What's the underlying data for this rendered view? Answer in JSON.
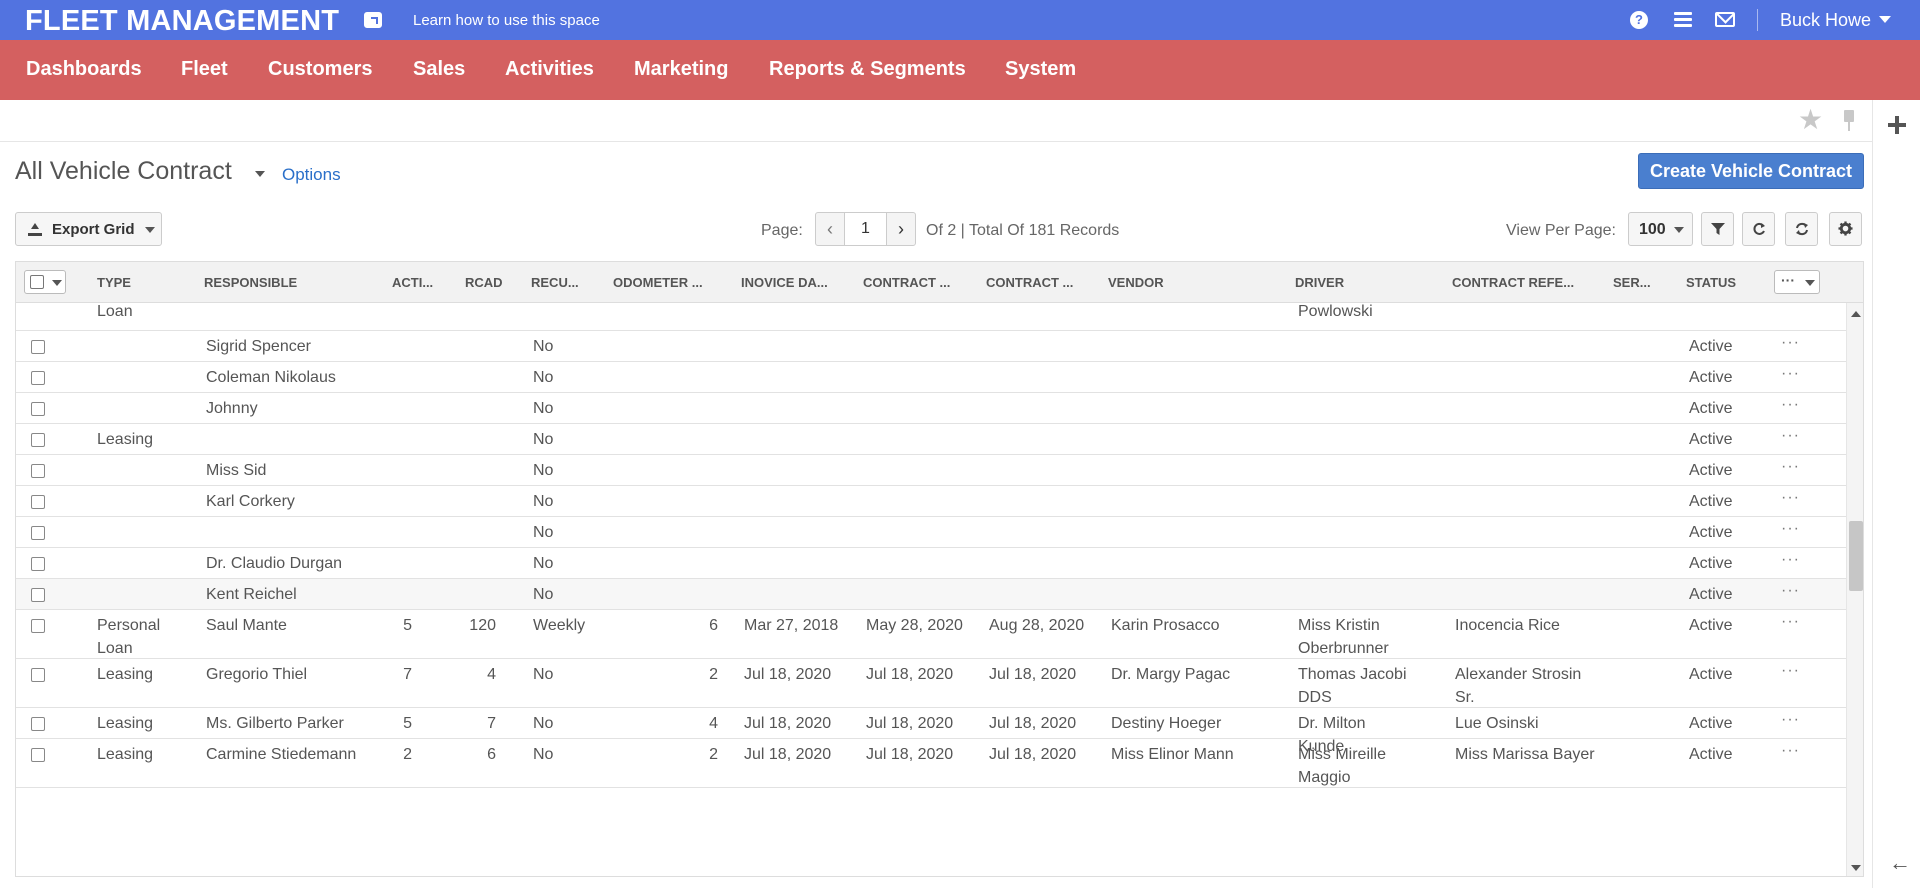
{
  "header": {
    "brand": "FLEET MANAGEMENT",
    "learn": "Learn how to use this space",
    "user": "Buck Howe",
    "icons": [
      "external-link-icon",
      "help-icon",
      "list-icon",
      "mail-icon"
    ]
  },
  "nav": [
    "Dashboards",
    "Fleet",
    "Customers",
    "Sales",
    "Activities",
    "Marketing",
    "Reports & Segments",
    "System"
  ],
  "page": {
    "title": "All Vehicle Contract",
    "options": "Options",
    "create_button": "Create Vehicle Contract"
  },
  "toolbar": {
    "export": "Export Grid",
    "page_label": "Page:",
    "page_value": "1",
    "records": "Of 2 | Total Of 181 Records",
    "view_per_page_label": "View Per Page:",
    "view_per_page_value": "100"
  },
  "grid": {
    "columns": [
      "TYPE",
      "RESPONSIBLE",
      "ACTI...",
      "RCAD",
      "RECU...",
      "ODOMETER ...",
      "INOVICE DA...",
      "CONTRACT ...",
      "CONTRACT ...",
      "VENDOR",
      "DRIVER",
      "CONTRACT REFE...",
      "SER...",
      "STATUS"
    ],
    "partial_row": {
      "type": "Loan",
      "driver": "Powlowski"
    },
    "rows": [
      {
        "type": "",
        "responsible": "Sigrid Spencer",
        "acti": "",
        "rcad": "",
        "recu": "No",
        "odometer": "",
        "invoice": "",
        "contract1": "",
        "contract2": "",
        "vendor": "",
        "driver": "",
        "contract_ref": "",
        "status": "Active"
      },
      {
        "type": "",
        "responsible": "Coleman Nikolaus",
        "acti": "",
        "rcad": "",
        "recu": "No",
        "odometer": "",
        "invoice": "",
        "contract1": "",
        "contract2": "",
        "vendor": "",
        "driver": "",
        "contract_ref": "",
        "status": "Active"
      },
      {
        "type": "",
        "responsible": "Johnny",
        "acti": "",
        "rcad": "",
        "recu": "No",
        "odometer": "",
        "invoice": "",
        "contract1": "",
        "contract2": "",
        "vendor": "",
        "driver": "",
        "contract_ref": "",
        "status": "Active"
      },
      {
        "type": "Leasing",
        "responsible": "",
        "acti": "",
        "rcad": "",
        "recu": "No",
        "odometer": "",
        "invoice": "",
        "contract1": "",
        "contract2": "",
        "vendor": "",
        "driver": "",
        "contract_ref": "",
        "status": "Active"
      },
      {
        "type": "",
        "responsible": "Miss Sid",
        "acti": "",
        "rcad": "",
        "recu": "No",
        "odometer": "",
        "invoice": "",
        "contract1": "",
        "contract2": "",
        "vendor": "",
        "driver": "",
        "contract_ref": "",
        "status": "Active"
      },
      {
        "type": "",
        "responsible": "Karl Corkery",
        "acti": "",
        "rcad": "",
        "recu": "No",
        "odometer": "",
        "invoice": "",
        "contract1": "",
        "contract2": "",
        "vendor": "",
        "driver": "",
        "contract_ref": "",
        "status": "Active"
      },
      {
        "type": "",
        "responsible": "",
        "acti": "",
        "rcad": "",
        "recu": "No",
        "odometer": "",
        "invoice": "",
        "contract1": "",
        "contract2": "",
        "vendor": "",
        "driver": "",
        "contract_ref": "",
        "status": "Active"
      },
      {
        "type": "",
        "responsible": "Dr. Claudio Durgan",
        "acti": "",
        "rcad": "",
        "recu": "No",
        "odometer": "",
        "invoice": "",
        "contract1": "",
        "contract2": "",
        "vendor": "",
        "driver": "",
        "contract_ref": "",
        "status": "Active"
      },
      {
        "type": "",
        "responsible": "Kent Reichel",
        "acti": "",
        "rcad": "",
        "recu": "No",
        "odometer": "",
        "invoice": "",
        "contract1": "",
        "contract2": "",
        "vendor": "",
        "driver": "",
        "contract_ref": "",
        "status": "Active"
      },
      {
        "type": "Personal Loan",
        "responsible": "Saul Mante",
        "acti": "5",
        "rcad": "120",
        "recu": "Weekly",
        "odometer": "6",
        "invoice": "Mar 27, 2018",
        "contract1": "May 28, 2020",
        "contract2": "Aug 28, 2020",
        "vendor": "Karin Prosacco",
        "driver": "Miss Kristin Oberbrunner",
        "contract_ref": "Inocencia Rice",
        "status": "Active"
      },
      {
        "type": "Leasing",
        "responsible": "Gregorio Thiel",
        "acti": "7",
        "rcad": "4",
        "recu": "No",
        "odometer": "2",
        "invoice": "Jul 18, 2020",
        "contract1": "Jul 18, 2020",
        "contract2": "Jul 18, 2020",
        "vendor": "Dr. Margy Pagac",
        "driver": "Thomas Jacobi DDS",
        "contract_ref": "Alexander Strosin Sr.",
        "status": "Active"
      },
      {
        "type": "Leasing",
        "responsible": "Ms. Gilberto Parker",
        "acti": "5",
        "rcad": "7",
        "recu": "No",
        "odometer": "4",
        "invoice": "Jul 18, 2020",
        "contract1": "Jul 18, 2020",
        "contract2": "Jul 18, 2020",
        "vendor": "Destiny Hoeger",
        "driver": "Dr. Milton Kunde",
        "contract_ref": "Lue Osinski",
        "status": "Active"
      },
      {
        "type": "Leasing",
        "responsible": "Carmine Stiedemann",
        "acti": "2",
        "rcad": "6",
        "recu": "No",
        "odometer": "2",
        "invoice": "Jul 18, 2020",
        "contract1": "Jul 18, 2020",
        "contract2": "Jul 18, 2020",
        "vendor": "Miss Elinor Mann",
        "driver": "Miss Mireille Maggio",
        "contract_ref": "Miss Marissa Bayer",
        "status": "Active"
      }
    ]
  }
}
